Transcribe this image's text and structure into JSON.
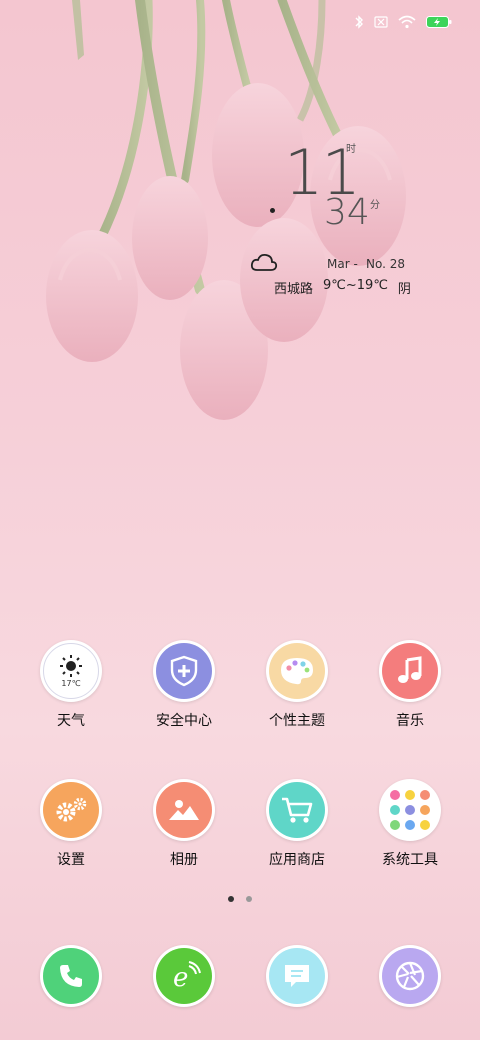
{
  "status_bar": {
    "icons": [
      "bluetooth-icon",
      "sim-none-icon",
      "wifi-icon",
      "battery-charging-icon"
    ],
    "battery_level": 1.0
  },
  "clock": {
    "hour": "11",
    "hour_unit": "时",
    "minute": "34",
    "minute_unit": "分",
    "month": "Mar -",
    "day": "No. 28"
  },
  "weather": {
    "icon": "cloud-icon",
    "location": "西城路",
    "temp_range": "9℃~19℃",
    "condition": "阴"
  },
  "apps_row1": [
    {
      "label": "天气",
      "icon": "weather-sun-icon",
      "sub": "17℃",
      "color": "#ffffff"
    },
    {
      "label": "安全中心",
      "icon": "shield-icon",
      "color": "#8c8fe0"
    },
    {
      "label": "个性主题",
      "icon": "palette-icon",
      "color": "#f8d9a4"
    },
    {
      "label": "音乐",
      "icon": "music-note-icon",
      "color": "#f47d7d"
    }
  ],
  "apps_row2": [
    {
      "label": "设置",
      "icon": "gears-icon",
      "color": "#f6a55d"
    },
    {
      "label": "相册",
      "icon": "gallery-mountain-icon",
      "color": "#f58d74"
    },
    {
      "label": "应用商店",
      "icon": "shopping-cart-icon",
      "color": "#5fd6c8"
    },
    {
      "label": "系统工具",
      "icon": "tools-folder-icon",
      "color": "#ffffff"
    }
  ],
  "page_indicator": {
    "pages": 2,
    "active": 0
  },
  "dock": [
    {
      "name": "phone",
      "icon": "phone-icon",
      "color": "#4fd27a"
    },
    {
      "name": "browser",
      "icon": "browser-e-icon",
      "color": "#5ac93a"
    },
    {
      "name": "messages",
      "icon": "message-icon",
      "color": "#a7e7f3"
    },
    {
      "name": "camera",
      "icon": "camera-aperture-icon",
      "color": "#b9a8f0"
    }
  ]
}
